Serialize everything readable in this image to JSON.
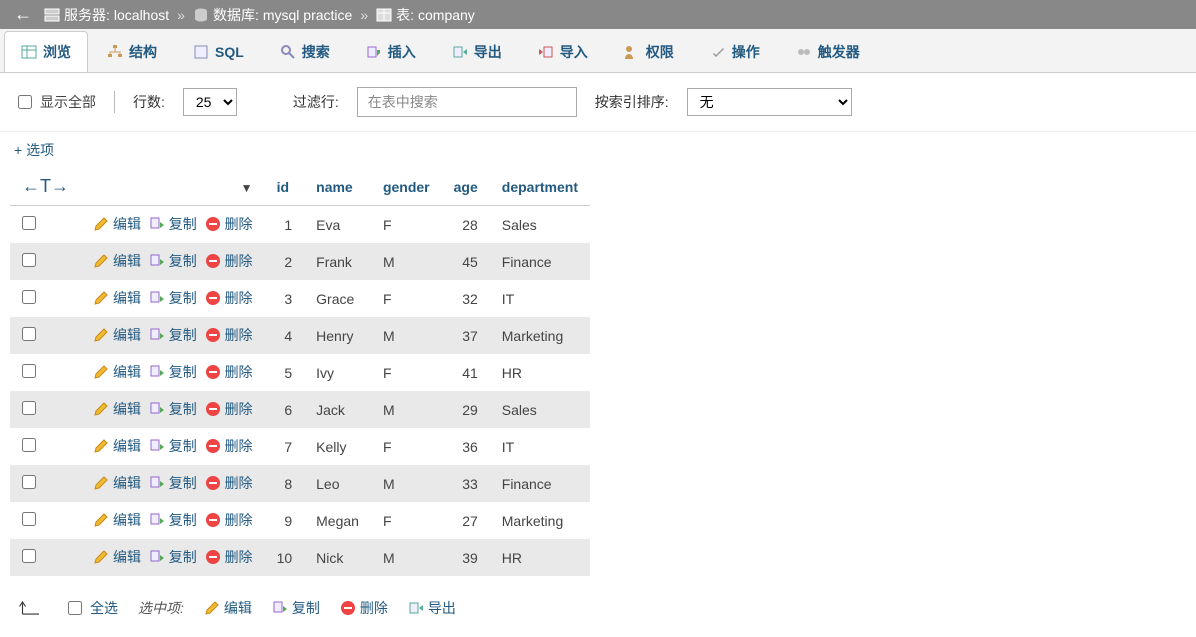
{
  "breadcrumb": {
    "server_label": "服务器:",
    "server_value": "localhost",
    "db_label": "数据库:",
    "db_value": "mysql practice",
    "table_label": "表:",
    "table_value": "company"
  },
  "tabs": {
    "browse": "浏览",
    "structure": "结构",
    "sql": "SQL",
    "search": "搜索",
    "insert": "插入",
    "export": "导出",
    "import": "导入",
    "privileges": "权限",
    "operations": "操作",
    "triggers": "触发器"
  },
  "toolbar": {
    "show_all": "显示全部",
    "rows": "行数:",
    "rows_value": "25",
    "filter_label": "过滤行:",
    "filter_placeholder": "在表中搜索",
    "sort_label": "按索引排序:",
    "sort_value": "无"
  },
  "options_link": "+ 选项",
  "columns": {
    "id": "id",
    "name": "name",
    "gender": "gender",
    "age": "age",
    "department": "department"
  },
  "row_actions": {
    "edit": "编辑",
    "copy": "复制",
    "delete": "删除"
  },
  "rows": [
    {
      "id": 1,
      "name": "Eva",
      "gender": "F",
      "age": 28,
      "department": "Sales"
    },
    {
      "id": 2,
      "name": "Frank",
      "gender": "M",
      "age": 45,
      "department": "Finance"
    },
    {
      "id": 3,
      "name": "Grace",
      "gender": "F",
      "age": 32,
      "department": "IT"
    },
    {
      "id": 4,
      "name": "Henry",
      "gender": "M",
      "age": 37,
      "department": "Marketing"
    },
    {
      "id": 5,
      "name": "Ivy",
      "gender": "F",
      "age": 41,
      "department": "HR"
    },
    {
      "id": 6,
      "name": "Jack",
      "gender": "M",
      "age": 29,
      "department": "Sales"
    },
    {
      "id": 7,
      "name": "Kelly",
      "gender": "F",
      "age": 36,
      "department": "IT"
    },
    {
      "id": 8,
      "name": "Leo",
      "gender": "M",
      "age": 33,
      "department": "Finance"
    },
    {
      "id": 9,
      "name": "Megan",
      "gender": "F",
      "age": 27,
      "department": "Marketing"
    },
    {
      "id": 10,
      "name": "Nick",
      "gender": "M",
      "age": 39,
      "department": "HR"
    }
  ],
  "footer": {
    "check_all": "全选",
    "with_selected": "选中项:",
    "edit": "编辑",
    "copy": "复制",
    "delete": "删除",
    "export": "导出"
  }
}
